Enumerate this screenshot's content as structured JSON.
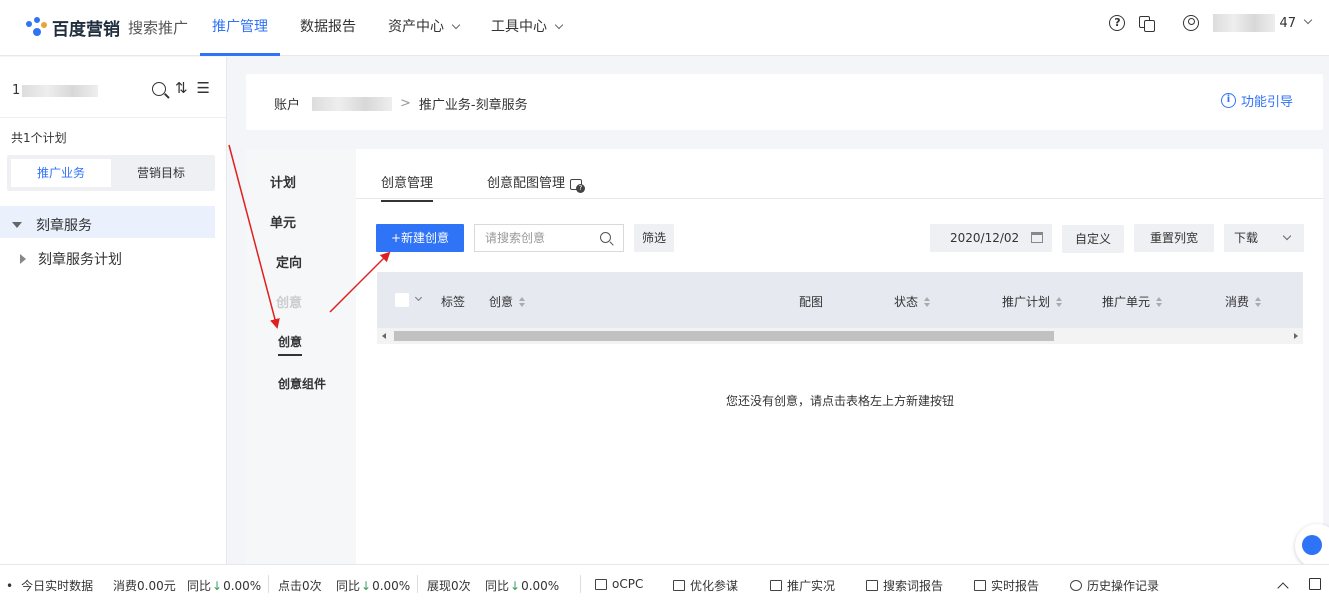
{
  "header": {
    "logo_brand": "百度营销",
    "logo_sub": "搜索推广",
    "nav": [
      {
        "label": "推广管理",
        "active": true,
        "dropdown": false
      },
      {
        "label": "数据报告",
        "active": false,
        "dropdown": false
      },
      {
        "label": "资产中心",
        "active": false,
        "dropdown": true
      },
      {
        "label": "工具中心",
        "active": false,
        "dropdown": true
      }
    ],
    "user_suffix": "47"
  },
  "sidebar": {
    "account_prefix": "1",
    "plan_count": "共1个计划",
    "tabs": [
      {
        "label": "推广业务",
        "active": true
      },
      {
        "label": "营销目标",
        "active": false
      }
    ],
    "tree": [
      {
        "label": "刻章服务",
        "expanded": true,
        "selected": true
      },
      {
        "label": "刻章服务计划",
        "expanded": false,
        "selected": false
      }
    ]
  },
  "breadcrumb": {
    "account_label": "账户",
    "separator": ">",
    "current": "推广业务-刻章服务",
    "guide_label": "功能引导"
  },
  "leftnav": {
    "items": [
      "计划",
      "单元",
      "定向",
      "创意"
    ],
    "sub_items": [
      "创意",
      "创意组件"
    ]
  },
  "tabs": [
    {
      "label": "创意管理",
      "active": true
    },
    {
      "label": "创意配图管理",
      "active": false
    }
  ],
  "toolbar": {
    "new_button": "+新建创意",
    "search_placeholder": "请搜索创意",
    "filter_button": "筛选",
    "date": "2020/12/02",
    "custom_button": "自定义",
    "reset_button": "重置列宽",
    "download_button": "下载"
  },
  "table": {
    "columns": [
      "标签",
      "创意",
      "配图",
      "状态",
      "推广计划",
      "推广单元",
      "消费"
    ],
    "empty_text": "您还没有创意，请点击表格左上方新建按钮"
  },
  "bottom_bar": {
    "realtime_label": "今日实时数据",
    "spend": "消费0.00元",
    "yoy1_label": "同比",
    "yoy1_value": "0.00%",
    "clicks": "点击0次",
    "yoy2_label": "同比",
    "yoy2_value": "0.00%",
    "impressions": "展现0次",
    "yoy3_label": "同比",
    "yoy3_value": "0.00%",
    "tools": [
      "oCPC",
      "优化参谋",
      "推广实况",
      "搜索词报告",
      "实时报告",
      "历史操作记录"
    ]
  },
  "colors": {
    "accent": "#2f73f6",
    "annotation_arrow": "#e02020",
    "down_trend": "#2f9e5c"
  }
}
